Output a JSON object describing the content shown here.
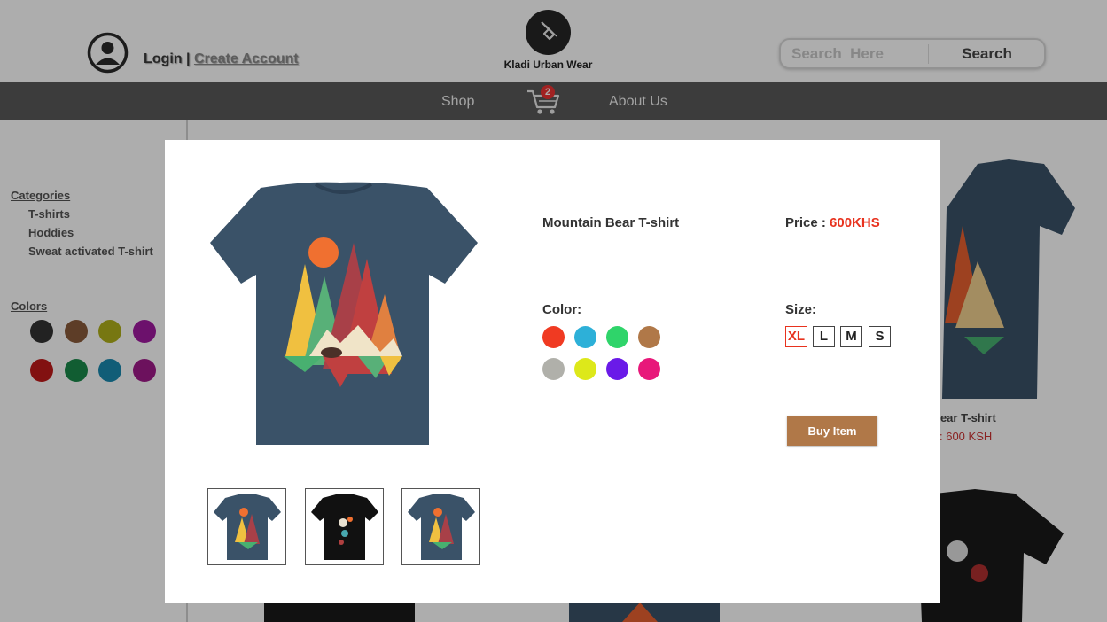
{
  "header": {
    "login_label": "Login",
    "separator": "|",
    "create_account_label": "Create Account",
    "brand_name": "Kladi Urban Wear",
    "search_placeholder": "Search  Here",
    "search_button": "Search"
  },
  "nav": {
    "shop": "Shop",
    "cart_count": "2",
    "about": "About Us"
  },
  "sidebar": {
    "categories_heading": "Categories",
    "categories": [
      "T-shirts",
      "Hoddies",
      "Sweat activated T-shirt"
    ],
    "colors_heading": "Colors",
    "colors": [
      "#333333",
      "#8a5a3a",
      "#b0b01a",
      "#a01aa0",
      "#c01a1a",
      "#1a8a4a",
      "#1a8ab0",
      "#a01a8a"
    ]
  },
  "background_products": {
    "name_partial": "n Bear T-shirt",
    "price_partial": ": 600 KSH"
  },
  "modal": {
    "product_name": "Mountain Bear T-shirt",
    "price_label": "Price :",
    "price_value": "600KHS",
    "color_label": "Color:",
    "colors": [
      "#f03a22",
      "#2db0d8",
      "#2fd46a",
      "#b07848",
      "#b0b0aa",
      "#dde81a",
      "#6a1ae8",
      "#e8187a"
    ],
    "size_label": "Size:",
    "sizes": [
      "XL",
      "L",
      "M",
      "S"
    ],
    "selected_size": "XL",
    "buy_label": "Buy Item"
  },
  "colors": {
    "navbar": "#595959",
    "price_accent": "#e8321e",
    "buy_button": "#b07848",
    "shirt_navy": "#3a5268"
  }
}
